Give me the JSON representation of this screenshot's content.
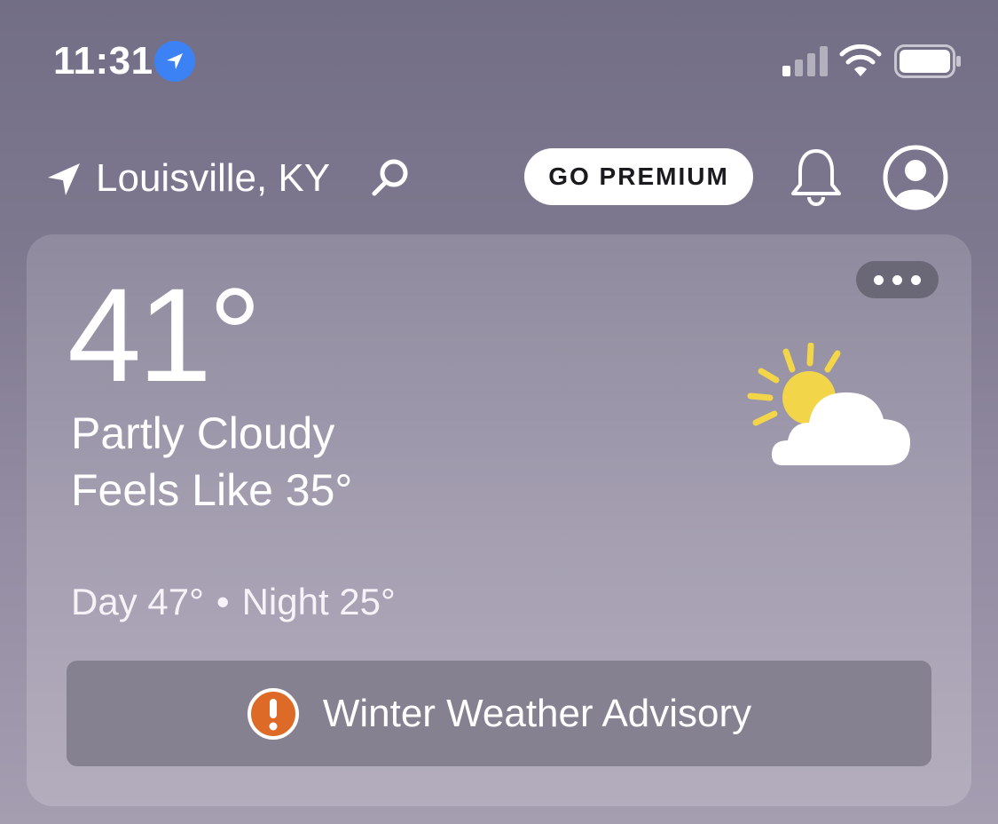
{
  "status_bar": {
    "time": "11:31",
    "icons": [
      "location-arrow-icon",
      "signal-icon",
      "wifi-icon",
      "battery-icon"
    ]
  },
  "header": {
    "location": "Louisville, KY",
    "premium_label": "GO PREMIUM",
    "icons": [
      "location-arrow-icon",
      "search-icon",
      "bell-icon",
      "account-icon"
    ]
  },
  "current": {
    "temperature": "41°",
    "condition": "Partly Cloudy",
    "feels_like": "Feels Like 35°",
    "day": "Day 47°",
    "separator": "•",
    "night": "Night 25°",
    "weather_icon": "partly-cloudy-icon"
  },
  "advisory": {
    "label": "Winter Weather Advisory",
    "icon": "alert-icon"
  },
  "colors": {
    "background": "#767189",
    "accent_blue": "#3d82f5",
    "alert_orange": "#de6a28",
    "sun_yellow": "#f3d54a",
    "advisory_bg": "#858190"
  }
}
